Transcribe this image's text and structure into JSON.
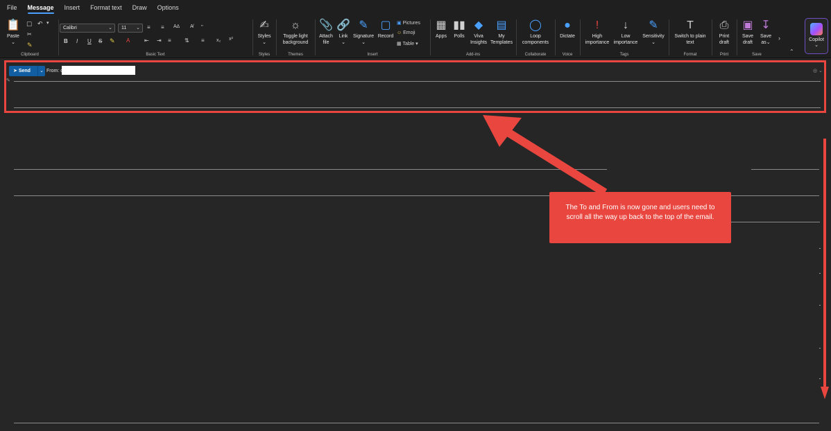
{
  "menu": {
    "tabs": [
      "File",
      "Message",
      "Insert",
      "Format text",
      "Draw",
      "Options"
    ],
    "active": "Message"
  },
  "ribbon": {
    "clipboard": {
      "paste": "Paste",
      "label": "Clipboard"
    },
    "basic_text": {
      "font": "Calibri",
      "size": "11",
      "label": "Basic Text",
      "bold": "B",
      "italic": "I",
      "underline": "U",
      "strike": "S"
    },
    "styles": {
      "styles": "Styles",
      "label": "Styles"
    },
    "themes": {
      "toggle_line1": "Toggle light",
      "toggle_line2": "background",
      "label": "Themes"
    },
    "insert": {
      "attach_line1": "Attach",
      "attach_line2": "file",
      "link": "Link",
      "signature": "Signature",
      "record": "Record",
      "pictures": "Pictures",
      "emoji": "Emoji",
      "table": "Table",
      "label": "Insert"
    },
    "addins": {
      "apps": "Apps",
      "polls": "Polls",
      "viva_line1": "Viva",
      "viva_line2": "Insights",
      "templates_line1": "My",
      "templates_line2": "Templates",
      "label": "Add-ins"
    },
    "collaborate": {
      "loop_line1": "Loop",
      "loop_line2": "components",
      "label": "Collaborate"
    },
    "voice": {
      "dictate": "Dictate",
      "label": "Voice"
    },
    "tags": {
      "high_line1": "High",
      "high_line2": "importance",
      "low_line1": "Low",
      "low_line2": "importance",
      "sensitivity": "Sensitivity",
      "label": "Tags"
    },
    "format": {
      "switch_line1": "Switch to plain",
      "switch_line2": "text",
      "label": "Format"
    },
    "print": {
      "print_line1": "Print",
      "print_line2": "draft",
      "label": "Print"
    },
    "save": {
      "save_line1": "Save",
      "save_line2": "draft",
      "saveas_line1": "Save",
      "saveas_line2": "as",
      "label": "Save"
    },
    "copilot": "Copilot"
  },
  "compose": {
    "send": "Send",
    "from": "From: c"
  },
  "callout": {
    "text": "The To and From is now gone and users need to scroll all the way up back to the top of the email."
  },
  "colors": {
    "annotation_red": "#e8463f",
    "send_blue": "#115ea3",
    "accent": "#4aa0ff"
  }
}
